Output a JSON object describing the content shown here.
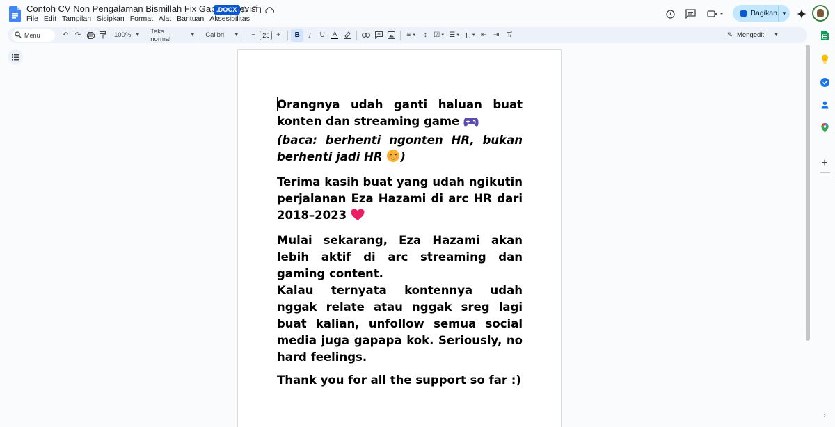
{
  "app": {
    "doc_title": "Contoh CV Non Pengalaman Bismillah Fix Gapake Revisi",
    "file_badge": ".DOCX",
    "menus": [
      "File",
      "Edit",
      "Tampilan",
      "Sisipkan",
      "Format",
      "Alat",
      "Bantuan",
      "Aksesibilitas"
    ],
    "share_label": "Bagikan"
  },
  "toolbar": {
    "search_placeholder": "Menu",
    "zoom": "100%",
    "style": "Teks normal",
    "font": "Calibri",
    "font_size": "25",
    "mode": "Mengedit"
  },
  "document": {
    "p1_line1": "Orangnya udah ganti haluan buat konten dan streaming game",
    "p1_line2": "(baca: berhenti ngonten HR, bukan berhenti jadi HR",
    "p1_line2_end": ")",
    "p2": "Terima kasih buat yang udah ngikutin perjalanan Eza Hazami di arc HR dari 2018–2023",
    "p3a": "Mulai sekarang, Eza Hazami akan lebih aktif di arc streaming dan gaming content.",
    "p3b": "Kalau ternyata kontennya udah nggak relate atau nggak sreg lagi buat kalian, unfollow semua social media juga gapapa kok. Seriously, no hard feelings.",
    "p4": "Thank you for all the support so far :)"
  },
  "colors": {
    "accent": "#0b57d0",
    "share_bg": "#c2e7ff",
    "toolbar_bg": "#edf2fa",
    "heart": "#e91e63"
  }
}
